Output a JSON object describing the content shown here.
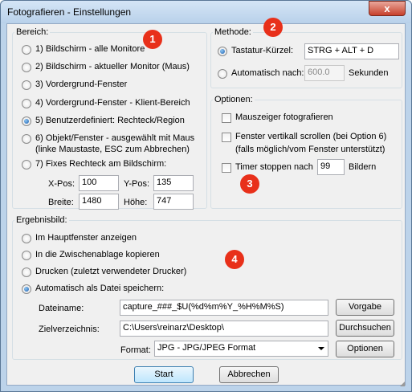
{
  "window": {
    "title": "Fotografieren - Einstellungen",
    "close_glyph": "x"
  },
  "markers": [
    "1",
    "2",
    "3",
    "4"
  ],
  "bereich": {
    "legend": "Bereich:",
    "options": [
      {
        "label": "1) Bildschirm - alle Monitore",
        "checked": false
      },
      {
        "label": "2) Bildschirm - aktueller Monitor (Maus)",
        "checked": false
      },
      {
        "label": "3) Vordergrund-Fenster",
        "checked": false
      },
      {
        "label": "4) Vordergrund-Fenster - Klient-Bereich",
        "checked": false
      },
      {
        "label": "5) Benutzerdefiniert: Rechteck/Region",
        "checked": true
      },
      {
        "label": "6) Objekt/Fenster - ausgewählt mit Maus",
        "sub": "(linke Maustaste, ESC zum Abbrechen)",
        "checked": false
      },
      {
        "label": "7) Fixes Rechteck am Bildschirm:",
        "checked": false
      }
    ],
    "fields": {
      "xpos_label": "X-Pos:",
      "xpos_value": "100",
      "ypos_label": "Y-Pos:",
      "ypos_value": "135",
      "breite_label": "Breite:",
      "breite_value": "1480",
      "hoehe_label": "Höhe:",
      "hoehe_value": "747"
    }
  },
  "methode": {
    "legend": "Methode:",
    "hotkey_label": "Tastatur-Kürzel:",
    "hotkey_value": "STRG + ALT + D",
    "auto_label": "Automatisch nach:",
    "auto_value": "600.0",
    "auto_unit": "Sekunden"
  },
  "optionen": {
    "legend": "Optionen:",
    "mouse_label": "Mauszeiger fotografieren",
    "scroll_label": "Fenster vertikall scrollen (bei Option 6)",
    "scroll_sub": "(falls möglich/vom Fenster unterstützt)",
    "timer_label": "Timer stoppen nach",
    "timer_value": "99",
    "timer_unit": "Bildern"
  },
  "ergebnis": {
    "legend": "Ergebnisbild:",
    "options": [
      {
        "label": "Im Hauptfenster anzeigen",
        "checked": false
      },
      {
        "label": "In die Zwischenablage kopieren",
        "checked": false
      },
      {
        "label": "Drucken (zuletzt verwendeter Drucker)",
        "checked": false
      },
      {
        "label": "Automatisch als Datei speichern:",
        "checked": true
      }
    ],
    "dateiname_label": "Dateiname:",
    "dateiname_value": "capture_###_$U(%d%m%Y_%H%M%S)",
    "vorgabe_button": "Vorgabe",
    "ziel_label": "Zielverzeichnis:",
    "ziel_value": "C:\\Users\\reinarz\\Desktop\\",
    "durchsuchen_button": "Durchsuchen",
    "format_label": "Format:",
    "format_value": "JPG - JPG/JPEG Format",
    "optionen_button": "Optionen"
  },
  "footer": {
    "start_button": "Start",
    "abbrechen_button": "Abbrechen"
  }
}
